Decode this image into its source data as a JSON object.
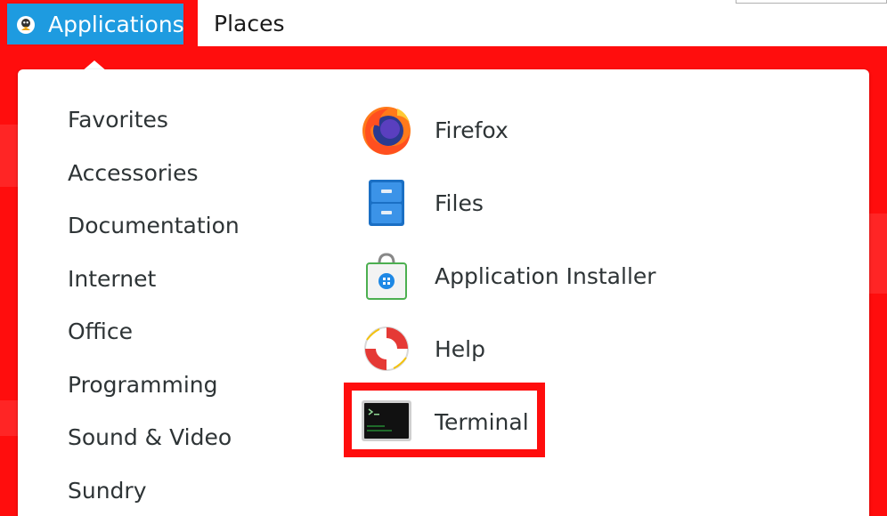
{
  "topbar": {
    "applications_label": "Applications",
    "places_label": "Places"
  },
  "menu": {
    "categories": [
      {
        "label": "Favorites"
      },
      {
        "label": "Accessories"
      },
      {
        "label": "Documentation"
      },
      {
        "label": "Internet"
      },
      {
        "label": "Office"
      },
      {
        "label": "Programming"
      },
      {
        "label": "Sound & Video"
      },
      {
        "label": "Sundry"
      }
    ],
    "apps": [
      {
        "label": "Firefox",
        "icon": "firefox-icon"
      },
      {
        "label": "Files",
        "icon": "files-icon"
      },
      {
        "label": "Application Installer",
        "icon": "software-installer-icon"
      },
      {
        "label": "Help",
        "icon": "help-lifebuoy-icon"
      },
      {
        "label": "Terminal",
        "icon": "terminal-icon"
      }
    ]
  },
  "colors": {
    "annotation_red": "#ff0d0d",
    "applications_highlight": "#1e9be0"
  }
}
